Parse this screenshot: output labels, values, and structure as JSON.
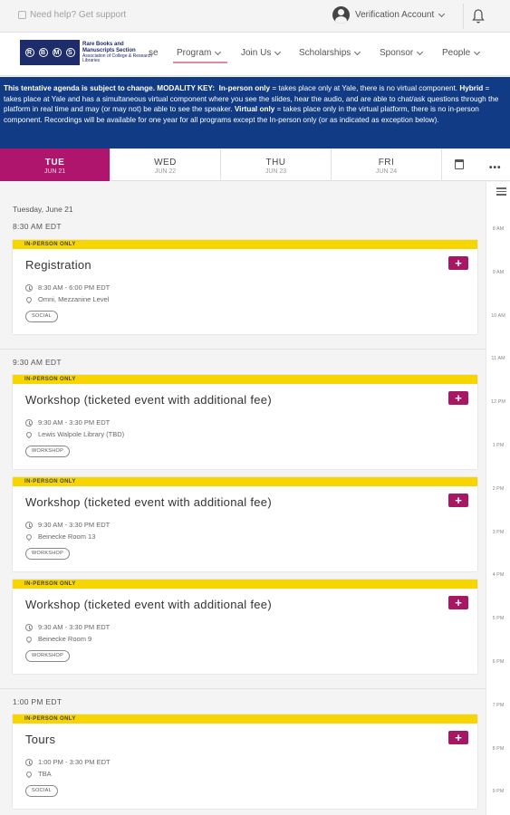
{
  "topbar": {
    "help": "Need help? Get support",
    "account": "Verification Account"
  },
  "logo": {
    "letters": [
      "R",
      "B",
      "M",
      "S"
    ],
    "name": "Rare Books and Manuscripts Section",
    "sub": "Association of College & Research Libraries"
  },
  "nav": {
    "partial": "se",
    "items": [
      "Program",
      "Join Us",
      "Scholarships",
      "Sponsor",
      "People"
    ],
    "active": "Program"
  },
  "banner": {
    "intro": "This tentative agenda is subject to change. MODALITY KEY:",
    "inperson_label": "In-person only",
    "inperson_text": " = takes place only at Yale, there is no virtual component. ",
    "hybrid_label": "Hybrid",
    "hybrid_text": " = takes place at Yale and has a simultaneous virtual component where you see the slides, hear the audio, and are able to chat/ask questions through the platform in real time and may (or may not) be able to see the speaker. ",
    "virtual_label": "Virtual only",
    "virtual_text": " = takes place only in the virtual platform, there is no in-person component.  Recordings will be available for one year for all programs except the In-person only (or as indicated as exception below)."
  },
  "days": [
    {
      "name": "TUE",
      "date": "JUN 21",
      "active": true
    },
    {
      "name": "WED",
      "date": "JUN 22",
      "active": false
    },
    {
      "name": "THU",
      "date": "JUN 23",
      "active": false
    },
    {
      "name": "FRI",
      "date": "JUN 24",
      "active": false
    }
  ],
  "timeline": [
    "8 AM",
    "9 AM",
    "10 AM",
    "11 AM",
    "12 PM",
    "1 PM",
    "2 PM",
    "3 PM",
    "4 PM",
    "5 PM",
    "6 PM",
    "7 PM",
    "8 PM",
    "9 PM"
  ],
  "schedule": {
    "day_label": "Tuesday, June 21",
    "groups": [
      {
        "time": "8:30 AM EDT",
        "events": [
          {
            "modality": "IN-PERSON ONLY",
            "title": "Registration",
            "time": "8:30 AM - 6:00 PM EDT",
            "location": "Omni, Mezzanine Level",
            "tag": "SOCIAL"
          }
        ]
      },
      {
        "time": "9:30 AM EDT",
        "events": [
          {
            "modality": "IN-PERSON ONLY",
            "title": "Workshop (ticketed event with additional fee)",
            "time": "9:30 AM - 3:30 PM EDT",
            "location": "Lewis Walpole Library (TBD)",
            "tag": "WORKSHOP"
          },
          {
            "modality": "IN-PERSON ONLY",
            "title": "Workshop (ticketed event with additional fee)",
            "time": "9:30 AM - 3:30 PM EDT",
            "location": "Beinecke Room 13",
            "tag": "WORKSHOP"
          },
          {
            "modality": "IN-PERSON ONLY",
            "title": "Workshop (ticketed event with additional fee)",
            "time": "9:30 AM - 3:30 PM EDT",
            "location": "Beinecke Room 9",
            "tag": "WORKSHOP"
          }
        ]
      },
      {
        "time": "1:00 PM EDT",
        "events": [
          {
            "modality": "IN-PERSON ONLY",
            "title": "Tours",
            "time": "1:00 PM - 3:30 PM EDT",
            "location": "TBA",
            "tag": "SOCIAL"
          }
        ]
      }
    ]
  },
  "add_label": "+"
}
